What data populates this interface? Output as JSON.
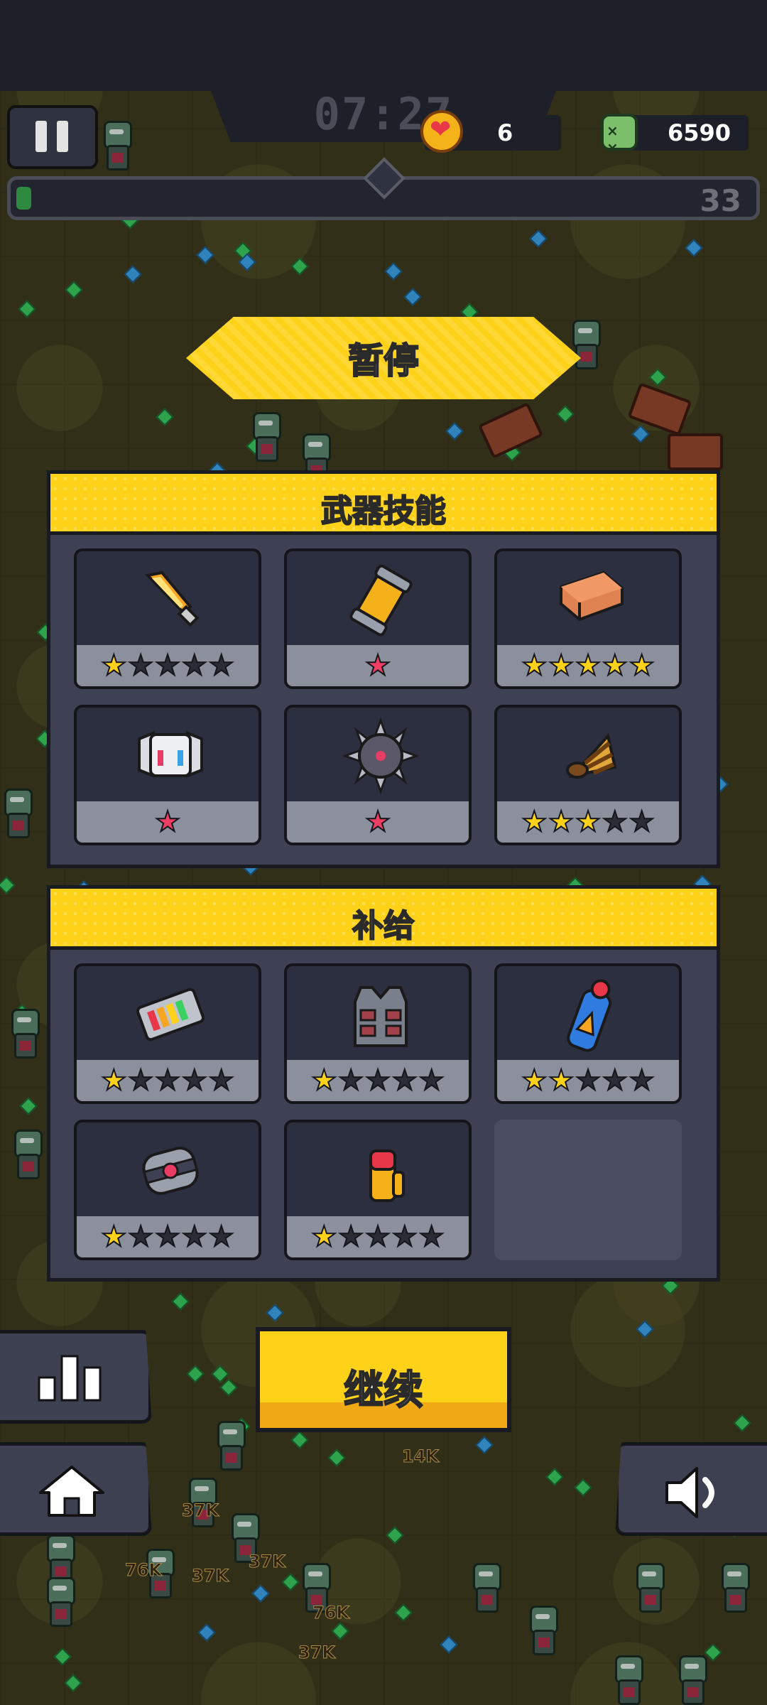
{
  "hud": {
    "timer": "07:27",
    "hp": "6",
    "kills": "6590",
    "level": "33",
    "xp_progress": 0.02
  },
  "pause": {
    "title": "暂停",
    "weapons_title": "武器技能",
    "supplies_title": "补给",
    "continue_label": "继续"
  },
  "weapons": [
    {
      "name": "flame-sword-icon",
      "stars": 1,
      "max": 5,
      "style": "yellow"
    },
    {
      "name": "canister-grenade-icon",
      "stars": 1,
      "max": 1,
      "style": "red"
    },
    {
      "name": "brick-icon",
      "stars": 5,
      "max": 5,
      "style": "yellow"
    },
    {
      "name": "drone-robot-icon",
      "stars": 1,
      "max": 1,
      "style": "red"
    },
    {
      "name": "spiked-mine-icon",
      "stars": 1,
      "max": 1,
      "style": "red"
    },
    {
      "name": "drill-icon",
      "stars": 3,
      "max": 5,
      "style": "yellow"
    }
  ],
  "supplies": [
    {
      "name": "battery-icon",
      "stars": 1,
      "max": 5,
      "style": "yellow"
    },
    {
      "name": "armor-vest-icon",
      "stars": 1,
      "max": 5,
      "style": "yellow"
    },
    {
      "name": "energy-drink-icon",
      "stars": 2,
      "max": 5,
      "style": "yellow"
    },
    {
      "name": "magnet-core-icon",
      "stars": 1,
      "max": 5,
      "style": "yellow"
    },
    {
      "name": "ammo-shell-icon",
      "stars": 1,
      "max": 5,
      "style": "yellow"
    }
  ],
  "world": {
    "damage_numbers": [
      "14K",
      "37K",
      "37K",
      "37K",
      "76K",
      "76K",
      "37K"
    ]
  }
}
